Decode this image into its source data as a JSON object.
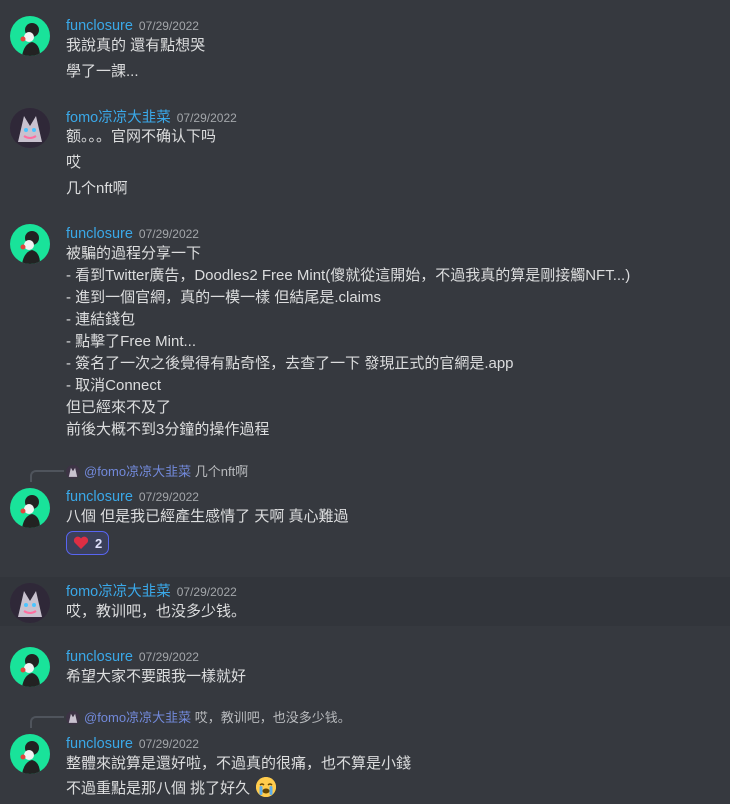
{
  "messages": [
    {
      "author": "funclosure",
      "timestamp": "07/29/2022",
      "lines": [
        "我說真的 還有點想哭",
        "學了一課..."
      ]
    },
    {
      "author": "fomo凉凉大韭菜",
      "timestamp": "07/29/2022",
      "lines": [
        "额。。。官网不确认下吗",
        "哎",
        "几个nft啊"
      ]
    },
    {
      "author": "funclosure",
      "timestamp": "07/29/2022",
      "lines": [
        "被騙的過程分享一下",
        "- 看到Twitter廣告，Doodles2 Free Mint(傻就從這開始，不過我真的算是剛接觸NFT...)",
        "- 進到一個官網，真的一模一樣 但結尾是.claims",
        "- 連結錢包",
        "- 點擊了Free Mint...",
        "- 簽名了一次之後覺得有點奇怪，去查了一下 發現正式的官網是.app",
        "- 取消Connect",
        "但已經來不及了",
        "前後大概不到3分鐘的操作過程"
      ]
    },
    {
      "reply_mention": "@fomo凉凉大韭菜",
      "reply_text": "几个nft啊",
      "author": "funclosure",
      "timestamp": "07/29/2022",
      "lines": [
        "八個 但是我已經產生感情了 天啊 真心難過"
      ],
      "reaction": {
        "emoji": "heart",
        "count": "2"
      }
    },
    {
      "author": "fomo凉凉大韭菜",
      "timestamp": "07/29/2022",
      "lines": [
        "哎，教训吧，也没多少钱。"
      ]
    },
    {
      "author": "funclosure",
      "timestamp": "07/29/2022",
      "lines": [
        "希望大家不要跟我一樣就好"
      ]
    },
    {
      "reply_mention": "@fomo凉凉大韭菜",
      "reply_text": "哎，教训吧，也没多少钱。",
      "author": "funclosure",
      "timestamp": "07/29/2022",
      "lines": [
        "整體來說算是還好啦，不過真的很痛，也不算是小錢",
        "不過重點是那八個 挑了好久"
      ],
      "trailing_emoji": "loudly-crying-face"
    }
  ],
  "colors": {
    "background": "#36393f",
    "author": "#3aa8e8",
    "mention": "#7289da",
    "reaction_border": "#5865f2"
  }
}
